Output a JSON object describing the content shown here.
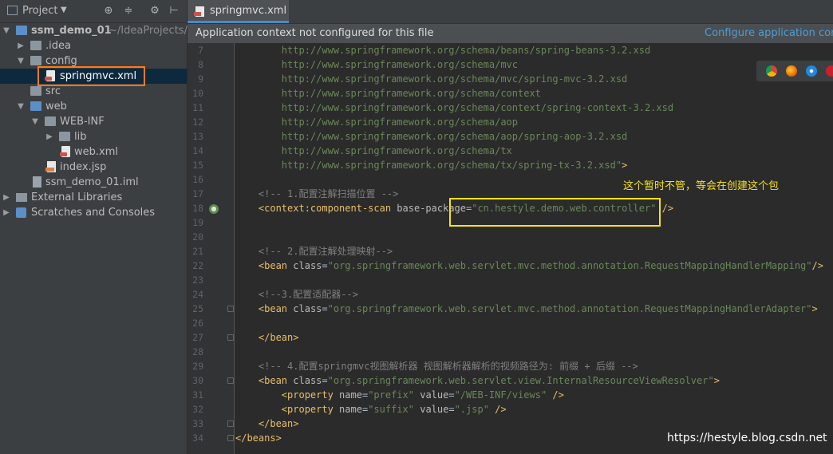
{
  "sidebar": {
    "title": "Project",
    "tree": [
      {
        "label": "ssm_demo_01",
        "path": "~/IdeaProjects/s",
        "bold": true
      },
      {
        "label": ".idea"
      },
      {
        "label": "config"
      },
      {
        "label": "springmvc.xml"
      },
      {
        "label": "src"
      },
      {
        "label": "web"
      },
      {
        "label": "WEB-INF"
      },
      {
        "label": "lib"
      },
      {
        "label": "web.xml"
      },
      {
        "label": "index.jsp"
      },
      {
        "label": "ssm_demo_01.iml"
      },
      {
        "label": "External Libraries"
      },
      {
        "label": "Scratches and Consoles"
      }
    ]
  },
  "tab": {
    "label": "springmvc.xml"
  },
  "notice": {
    "text": "Application context not configured for this file",
    "link": "Configure application cont"
  },
  "annotation": "这个暂时不管，等会在创建这个包",
  "watermark": "https://hestyle.blog.csdn.net",
  "colors": {
    "accent": "#4a88c7",
    "highlight_orange": "#ff7a1a",
    "highlight_yellow": "#f5e21a"
  },
  "code_lines": [
    {
      "n": "7",
      "segs": [
        {
          "t": "        ",
          "c": ""
        },
        {
          "t": "http://www.springframework.org/schema/beans/spring-beans-3.2.xsd",
          "c": "s"
        }
      ]
    },
    {
      "n": "8",
      "segs": [
        {
          "t": "        ",
          "c": ""
        },
        {
          "t": "http://www.springframework.org/schema/mvc",
          "c": "s"
        }
      ]
    },
    {
      "n": "9",
      "segs": [
        {
          "t": "        ",
          "c": ""
        },
        {
          "t": "http://www.springframework.org/schema/mvc/spring-mvc-3.2.xsd",
          "c": "s"
        }
      ]
    },
    {
      "n": "10",
      "segs": [
        {
          "t": "        ",
          "c": ""
        },
        {
          "t": "http://www.springframework.org/schema/context",
          "c": "s"
        }
      ]
    },
    {
      "n": "11",
      "segs": [
        {
          "t": "        ",
          "c": ""
        },
        {
          "t": "http://www.springframework.org/schema/context/spring-context-3.2.xsd",
          "c": "s"
        }
      ]
    },
    {
      "n": "12",
      "segs": [
        {
          "t": "        ",
          "c": ""
        },
        {
          "t": "http://www.springframework.org/schema/aop",
          "c": "s"
        }
      ]
    },
    {
      "n": "13",
      "segs": [
        {
          "t": "        ",
          "c": ""
        },
        {
          "t": "http://www.springframework.org/schema/aop/spring-aop-3.2.xsd",
          "c": "s"
        }
      ]
    },
    {
      "n": "14",
      "segs": [
        {
          "t": "        ",
          "c": ""
        },
        {
          "t": "http://www.springframework.org/schema/tx",
          "c": "s"
        }
      ]
    },
    {
      "n": "15",
      "segs": [
        {
          "t": "        ",
          "c": ""
        },
        {
          "t": "http://www.springframework.org/schema/tx/spring-tx-3.2.xsd\"",
          "c": "s"
        },
        {
          "t": ">",
          "c": "t"
        }
      ]
    },
    {
      "n": "16",
      "segs": []
    },
    {
      "n": "17",
      "segs": [
        {
          "t": "    ",
          "c": ""
        },
        {
          "t": "<!-- 1.配置注解扫描位置 -->",
          "c": "c"
        }
      ]
    },
    {
      "n": "18",
      "segs": [
        {
          "t": "    ",
          "c": ""
        },
        {
          "t": "<context",
          "c": "t"
        },
        {
          "t": ":component-scan ",
          "c": "t"
        },
        {
          "t": "base-package",
          "c": "a"
        },
        {
          "t": "=",
          "c": ""
        },
        {
          "t": "\"cn.hestyle.demo.web.controller\"",
          "c": "s"
        },
        {
          "t": " />",
          "c": "t"
        }
      ]
    },
    {
      "n": "19",
      "segs": []
    },
    {
      "n": "20",
      "segs": []
    },
    {
      "n": "21",
      "segs": [
        {
          "t": "    ",
          "c": ""
        },
        {
          "t": "<!-- 2.配置注解处理映射-->",
          "c": "c"
        }
      ]
    },
    {
      "n": "22",
      "segs": [
        {
          "t": "    ",
          "c": ""
        },
        {
          "t": "<bean ",
          "c": "t"
        },
        {
          "t": "class",
          "c": "a"
        },
        {
          "t": "=",
          "c": ""
        },
        {
          "t": "\"org.springframework.web.servlet.mvc.method.annotation.RequestMappingHandlerMapping\"",
          "c": "s"
        },
        {
          "t": "/>",
          "c": "t"
        }
      ]
    },
    {
      "n": "23",
      "segs": []
    },
    {
      "n": "24",
      "segs": [
        {
          "t": "    ",
          "c": ""
        },
        {
          "t": "<!--3.配置适配器-->",
          "c": "c"
        }
      ]
    },
    {
      "n": "25",
      "segs": [
        {
          "t": "    ",
          "c": ""
        },
        {
          "t": "<bean ",
          "c": "t"
        },
        {
          "t": "class",
          "c": "a"
        },
        {
          "t": "=",
          "c": ""
        },
        {
          "t": "\"org.springframework.web.servlet.mvc.method.annotation.RequestMappingHandlerAdapter\"",
          "c": "s"
        },
        {
          "t": ">",
          "c": "t"
        }
      ]
    },
    {
      "n": "26",
      "segs": []
    },
    {
      "n": "27",
      "segs": [
        {
          "t": "    ",
          "c": ""
        },
        {
          "t": "</bean>",
          "c": "t"
        }
      ]
    },
    {
      "n": "28",
      "segs": []
    },
    {
      "n": "29",
      "segs": [
        {
          "t": "    ",
          "c": ""
        },
        {
          "t": "<!-- 4.配置springmvc视图解析器 视图解析器解析的视频路径为: 前缀 + 后缀 -->",
          "c": "c"
        }
      ]
    },
    {
      "n": "30",
      "segs": [
        {
          "t": "    ",
          "c": ""
        },
        {
          "t": "<bean ",
          "c": "t"
        },
        {
          "t": "class",
          "c": "a"
        },
        {
          "t": "=",
          "c": ""
        },
        {
          "t": "\"org.springframework.web.servlet.view.InternalResourceViewResolver\"",
          "c": "s"
        },
        {
          "t": ">",
          "c": "t"
        }
      ]
    },
    {
      "n": "31",
      "segs": [
        {
          "t": "        ",
          "c": ""
        },
        {
          "t": "<property ",
          "c": "t"
        },
        {
          "t": "name",
          "c": "a"
        },
        {
          "t": "=",
          "c": ""
        },
        {
          "t": "\"prefix\"",
          "c": "s"
        },
        {
          "t": " ",
          "c": ""
        },
        {
          "t": "value",
          "c": "a"
        },
        {
          "t": "=",
          "c": ""
        },
        {
          "t": "\"/WEB-INF/views\"",
          "c": "s"
        },
        {
          "t": " />",
          "c": "t"
        }
      ]
    },
    {
      "n": "32",
      "segs": [
        {
          "t": "        ",
          "c": ""
        },
        {
          "t": "<property ",
          "c": "t"
        },
        {
          "t": "name",
          "c": "a"
        },
        {
          "t": "=",
          "c": ""
        },
        {
          "t": "\"suffix\"",
          "c": "s"
        },
        {
          "t": " ",
          "c": ""
        },
        {
          "t": "value",
          "c": "a"
        },
        {
          "t": "=",
          "c": ""
        },
        {
          "t": "\".jsp\"",
          "c": "s"
        },
        {
          "t": " />",
          "c": "t"
        }
      ]
    },
    {
      "n": "33",
      "segs": [
        {
          "t": "    ",
          "c": ""
        },
        {
          "t": "</bean>",
          "c": "t"
        }
      ]
    },
    {
      "n": "34",
      "segs": [
        {
          "t": "</beans>",
          "c": "t"
        }
      ]
    }
  ]
}
